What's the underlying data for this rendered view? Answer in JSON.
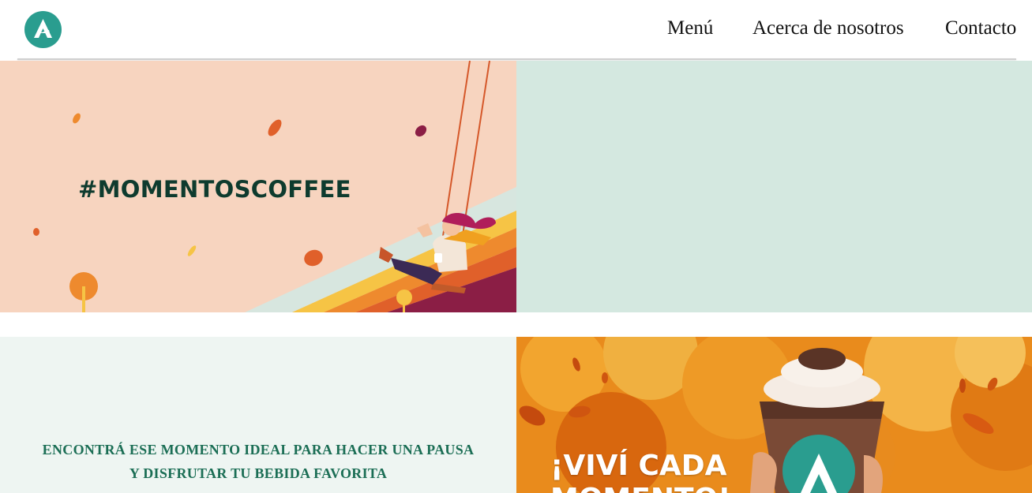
{
  "header": {
    "logo_icon": "brand-a-logo",
    "nav": [
      {
        "label": "Menú"
      },
      {
        "label": "Acerca de nosotros"
      },
      {
        "label": "Contacto"
      }
    ]
  },
  "hero": {
    "hashtag": "#MOMENTOSCOFFEE"
  },
  "promo": {
    "line1": "ENCONTRÁ ESE MOMENTO IDEAL PARA HACER UNA PAUSA",
    "line2": "Y DISFRUTAR TU BEBIDA FAVORITA",
    "headline_line1": "¡VIVÍ CADA",
    "headline_line2": "MOMENTO!"
  },
  "colors": {
    "brand": "#2a9d8f",
    "hero_left_bg": "#f7d4bf",
    "hero_right_bg": "#d4e8e0",
    "promo_left_bg": "#eef5f2",
    "promo_text": "#1b6e55",
    "hashtag_text": "#0e3b2e"
  }
}
